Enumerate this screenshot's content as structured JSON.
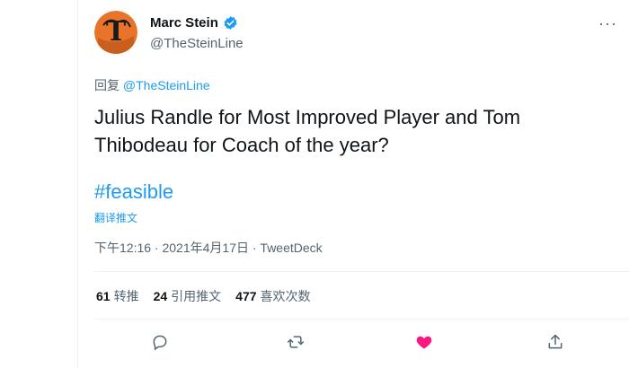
{
  "author": {
    "name": "Marc Stein",
    "handle": "@TheSteinLine",
    "verified": true
  },
  "reply": {
    "prefix": "回复",
    "to": "@TheSteinLine"
  },
  "tweet": {
    "text": "Julius Randle for Most Improved Player and Tom Thibodeau for Coach of the year?",
    "hashtag": "#feasible",
    "translate_label": "翻译推文",
    "timestamp": "下午12:16 · 2021年4月17日 · ",
    "client": "TweetDeck"
  },
  "stats": [
    {
      "count": "61",
      "label": "转推"
    },
    {
      "count": "24",
      "label": "引用推文"
    },
    {
      "count": "477",
      "label": "喜欢次数"
    }
  ],
  "actions": {
    "reply_icon": "reply-icon",
    "retweet_icon": "retweet-icon",
    "like_icon": "heart-icon",
    "share_icon": "share-icon"
  },
  "colors": {
    "accent": "#1d9bf0",
    "like": "#f91880",
    "muted": "#536471",
    "avatar_orange": "#e8742a"
  },
  "more_icon": "more-horizontal-icon"
}
